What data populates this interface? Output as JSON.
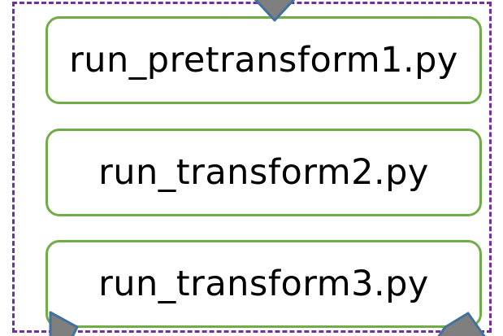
{
  "steps": [
    {
      "label": "run_pretransform1.py"
    },
    {
      "label": "run_transform2.py"
    },
    {
      "label": "run_transform3.py"
    }
  ],
  "colors": {
    "group_border": "#7030a0",
    "step_border": "#70ad47",
    "connector_fill": "#7f7f7f",
    "connector_stroke": "#41719c"
  },
  "icons": [
    "arrowhead-top",
    "arrowhead-bottom-left",
    "arrowhead-bottom-right"
  ]
}
